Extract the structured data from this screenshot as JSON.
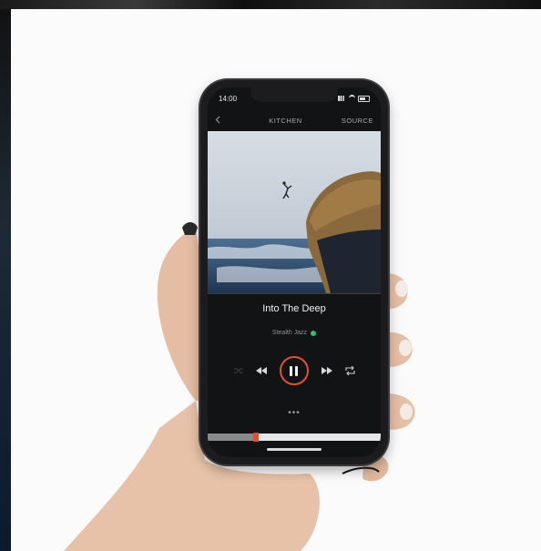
{
  "status_bar": {
    "time": "14:00"
  },
  "nav": {
    "back_icon": "chevron-left-icon",
    "title": "KITCHEN",
    "source_label": "SOURCE"
  },
  "track": {
    "title": "Into The Deep",
    "artist": "Stealth Jazz"
  },
  "playback": {
    "state": "playing",
    "volume_level": 0.28,
    "accent_color": "#e2512f",
    "online_color": "#2fbf71"
  },
  "controls": {
    "prev_icon": "rewind-icon",
    "play_pause_icon": "pause-icon",
    "next_icon": "fast-forward-icon",
    "repeat_icon": "repeat-icon",
    "more_label": "•••"
  }
}
